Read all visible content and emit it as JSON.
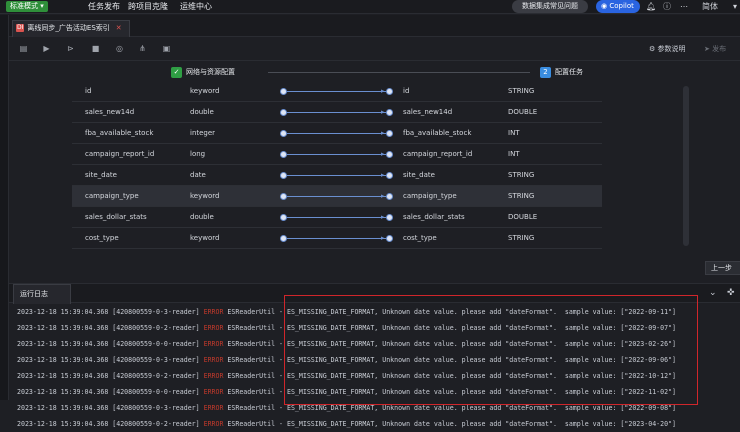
{
  "topbar": {
    "mode_label": "标准模式",
    "nav": [
      "任务发布",
      "跨项目克隆",
      "运维中心"
    ],
    "faq_button": "数据集成常见问题",
    "copilot_label": "Copilot",
    "lang_label": "简体",
    "icons": [
      "bell-icon",
      "help-icon",
      "more-icon"
    ]
  },
  "tabs": [
    {
      "badge": "DI",
      "label": "离线同步_广告活动ES索引"
    }
  ],
  "toolbar": {
    "icons": [
      "save-icon",
      "run-icon",
      "run-params-icon",
      "stop-icon",
      "reload-icon",
      "structure-icon",
      "format-icon"
    ],
    "params_label": "参数说明",
    "publish_label": "发布"
  },
  "steps": [
    {
      "num": "",
      "label": "网络与资源配置",
      "color": "#2f9e44"
    },
    {
      "num": "2",
      "label": "配置任务",
      "color": "#3a8de0"
    }
  ],
  "mapping": {
    "rows": [
      {
        "src_name": "id",
        "src_type": "keyword",
        "dst_name": "id",
        "dst_type": "STRING"
      },
      {
        "src_name": "sales_new14d",
        "src_type": "double",
        "dst_name": "sales_new14d",
        "dst_type": "DOUBLE"
      },
      {
        "src_name": "fba_available_stock",
        "src_type": "integer",
        "dst_name": "fba_available_stock",
        "dst_type": "INT"
      },
      {
        "src_name": "campaign_report_id",
        "src_type": "long",
        "dst_name": "campaign_report_id",
        "dst_type": "INT"
      },
      {
        "src_name": "site_date",
        "src_type": "date",
        "dst_name": "site_date",
        "dst_type": "STRING"
      },
      {
        "src_name": "campaign_type",
        "src_type": "keyword",
        "dst_name": "campaign_type",
        "dst_type": "STRING"
      },
      {
        "src_name": "sales_dollar_stats",
        "src_type": "double",
        "dst_name": "sales_dollar_stats",
        "dst_type": "DOUBLE"
      },
      {
        "src_name": "cost_type",
        "src_type": "keyword",
        "dst_name": "cost_type",
        "dst_type": "STRING"
      }
    ],
    "highlighted_row": 5
  },
  "prev_button": "上一步",
  "log": {
    "tab_label": "运行日志",
    "lines": [
      {
        "prefix": "2023-12-18 15:39:04.368 [420800559-0-3-reader] ",
        "level": "ERROR",
        "msg": " ESReaderUtil - ES_MISSING_DATE_FORMAT, Unknown date value. please add \"dateFormat\".  sample value: [\"2022-09-11\"]"
      },
      {
        "prefix": "2023-12-18 15:39:04.368 [420800559-0-2-reader] ",
        "level": "ERROR",
        "msg": " ESReaderUtil - ES_MISSING_DATE_FORMAT, Unknown date value. please add \"dateFormat\".  sample value: [\"2022-09-07\"]"
      },
      {
        "prefix": "2023-12-18 15:39:04.368 [420800559-0-0-reader] ",
        "level": "ERROR",
        "msg": " ESReaderUtil - ES_MISSING_DATE_FORMAT, Unknown date value. please add \"dateFormat\".  sample value: [\"2023-02-26\"]"
      },
      {
        "prefix": "2023-12-18 15:39:04.368 [420800559-0-3-reader] ",
        "level": "ERROR",
        "msg": " ESReaderUtil - ES_MISSING_DATE_FORMAT, Unknown date value. please add \"dateFormat\".  sample value: [\"2022-09-06\"]"
      },
      {
        "prefix": "2023-12-18 15:39:04.368 [420800559-0-2-reader] ",
        "level": "ERROR",
        "msg": " ESReaderUtil - ES_MISSING_DATE_FORMAT, Unknown date value. please add \"dateFormat\".  sample value: [\"2022-10-12\"]"
      },
      {
        "prefix": "2023-12-18 15:39:04.368 [420800559-0-0-reader] ",
        "level": "ERROR",
        "msg": " ESReaderUtil - ES_MISSING_DATE_FORMAT, Unknown date value. please add \"dateFormat\".  sample value: [\"2022-11-02\"]"
      },
      {
        "prefix": "2023-12-18 15:39:04.368 [420800559-0-3-reader] ",
        "level": "ERROR",
        "msg": " ESReaderUtil - ES_MISSING_DATE_FORMAT, Unknown date value. please add \"dateFormat\".  sample value: [\"2022-09-08\"]"
      },
      {
        "prefix": "2023-12-18 15:39:04.368 [420800559-0-2-reader] ",
        "level": "ERROR",
        "msg": " ESReaderUtil - ES_MISSING_DATE_FORMAT, Unknown date value. please add \"dateFormat\".  sample value: [\"2023-04-20\"]"
      }
    ]
  },
  "colors": {
    "accent": "#2a64e0",
    "error": "#c0392b",
    "highlight_box": "#d0262b",
    "mode_green": "#2f8f3a"
  }
}
